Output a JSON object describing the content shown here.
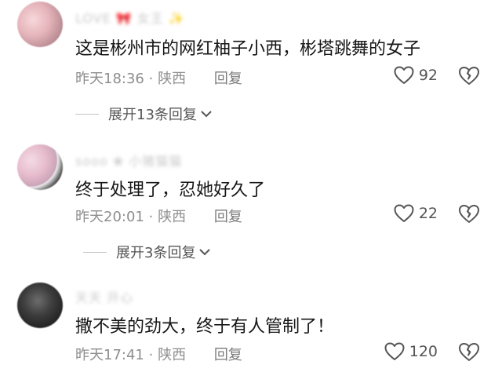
{
  "comments": [
    {
      "username": "LOVE 🎀 女王 ✨",
      "text": "这是彬州市的网红柚子小西，彬塔跳舞的女子",
      "time": "昨天18:36",
      "location": "陕西",
      "reply_label": "回复",
      "likes": "92",
      "expand_label": "展开13条回复"
    },
    {
      "username": "sooo ❀ 小猪猫猫",
      "text": "终于处理了，忍她好久了",
      "time": "昨天20:01",
      "location": "陕西",
      "reply_label": "回复",
      "likes": "22",
      "expand_label": "展开3条回复"
    },
    {
      "username": "天天 开心",
      "text": "撒不美的劲大，终于有人管制了！",
      "time": "昨天17:41",
      "location": "陕西",
      "reply_label": "回复",
      "likes": "120"
    }
  ],
  "meta_separator": "·",
  "colors": {
    "text": "#161616",
    "meta": "#8e8e8e",
    "icon": "#555555"
  }
}
